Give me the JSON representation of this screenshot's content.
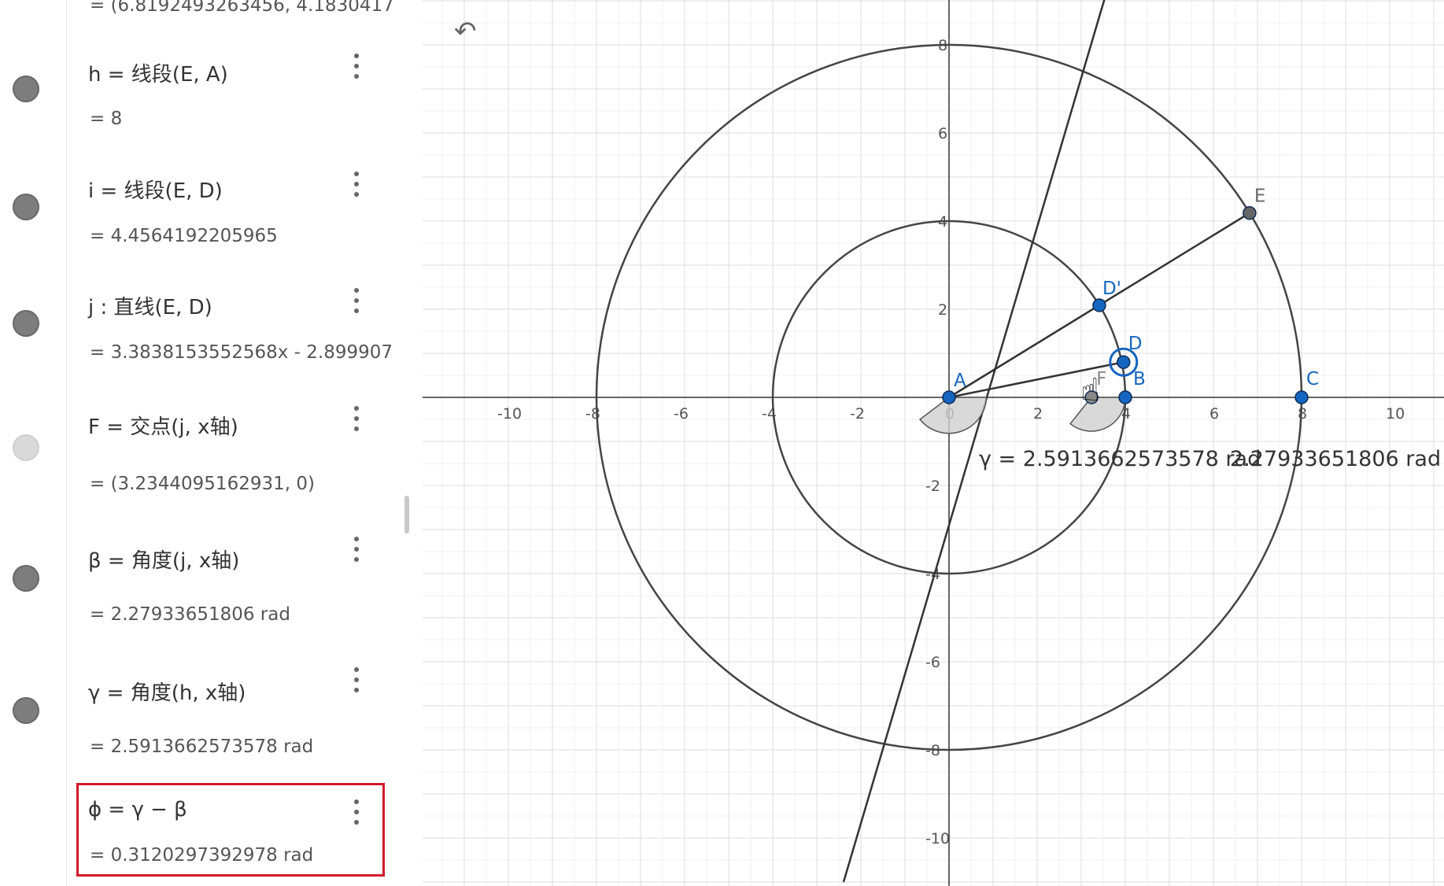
{
  "algebra": {
    "rows": [
      {
        "id": "g",
        "def_prefix": "",
        "def_body": "",
        "value": "=  (6.8192493263456,  4.1830417",
        "visible": true
      },
      {
        "id": "h",
        "def_prefix": "h  =  ",
        "def_body": "线段(E, A)",
        "value": "=  8",
        "visible": true
      },
      {
        "id": "i",
        "def_prefix": "i  =  ",
        "def_body": "线段(E, D)",
        "value": "=  4.4564192205965",
        "visible": true
      },
      {
        "id": "j",
        "def_prefix": "j : ",
        "def_body": "直线(E, D)",
        "value": "=  3.3838153552568x - 2.899907",
        "visible": true
      },
      {
        "id": "F",
        "def_prefix": "F  =  ",
        "def_body": "交点(j, x轴)",
        "value": "=  (3.2344095162931,  0)",
        "visible": false
      },
      {
        "id": "beta",
        "def_prefix": "β  =  ",
        "def_body": "角度(j, x轴)",
        "value": "=  2.27933651806 rad",
        "visible": true
      },
      {
        "id": "gamma",
        "def_prefix": "γ  =  ",
        "def_body": "角度(h, x轴)",
        "value": "=  2.5913662573578 rad",
        "visible": true
      },
      {
        "id": "phi",
        "def_prefix": "ϕ  =  ",
        "def_body": "γ − β",
        "value": "=  0.3120297392978 rad",
        "visible": null
      }
    ]
  },
  "graphics": {
    "undo_icon": "undo-icon",
    "x_ticks": [
      "-10",
      "-8",
      "-6",
      "-4",
      "-2",
      "0",
      "2",
      "4",
      "6",
      "8",
      "10"
    ],
    "y_ticks": [
      "8",
      "6",
      "4",
      "2",
      "-2",
      "-4",
      "-6",
      "-8",
      "-10"
    ],
    "points": {
      "A": {
        "label": "A",
        "x": 0,
        "y": 0
      },
      "B": {
        "label": "B",
        "x": 4,
        "y": 0
      },
      "C": {
        "label": "C",
        "x": 8,
        "y": 0
      },
      "D": {
        "label": "D",
        "x": 3.96,
        "y": 0.8
      },
      "D_prime": {
        "label": "D'",
        "x": 3.41,
        "y": 2.09
      },
      "E": {
        "label": "E",
        "x": 6.8192493263456,
        "y": 4.1830417
      },
      "F": {
        "label": "F",
        "x": 3.2344095162931,
        "y": 0
      }
    },
    "circles": [
      {
        "center": [
          0,
          0
        ],
        "r": 8
      },
      {
        "center": [
          0,
          0
        ],
        "r": 4
      }
    ],
    "angle_label": "γ = 2.5913662573578 rad",
    "angle_label2": "2.27933651806 rad"
  },
  "colors": {
    "point_blue": "#1565c0",
    "point_gray": "#555555",
    "highlight_red": "#d11a2a"
  }
}
